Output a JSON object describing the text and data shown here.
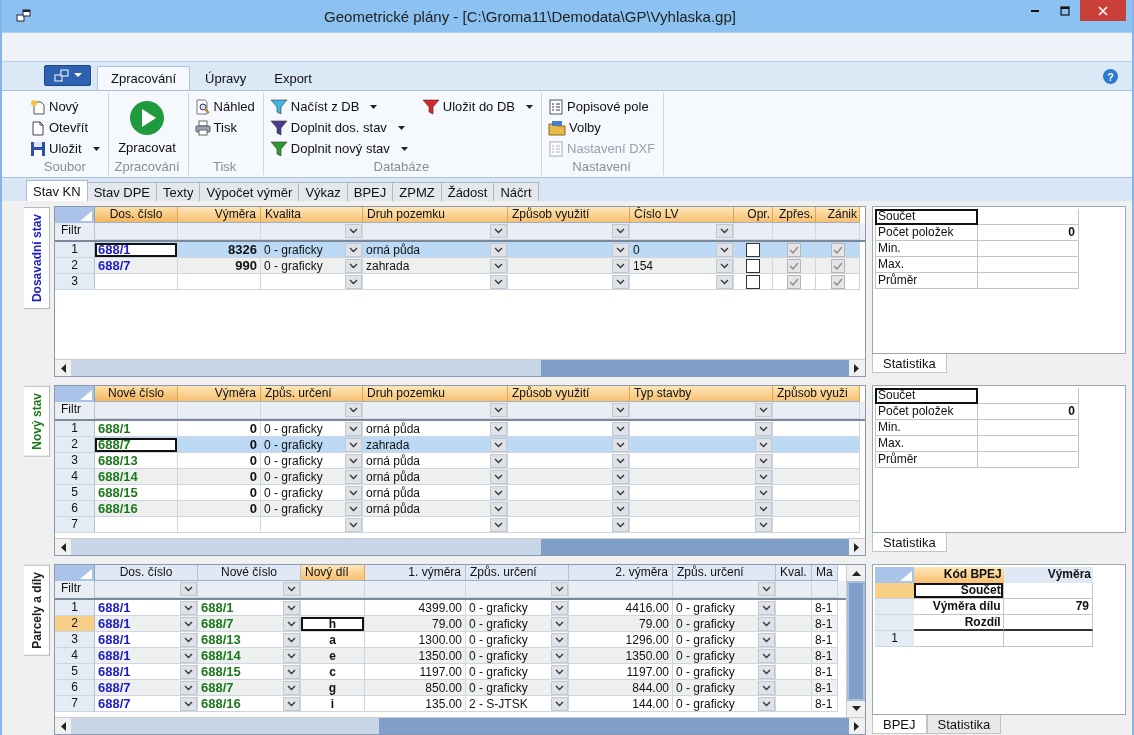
{
  "window": {
    "title": "Geometrické plány - [C:\\Groma11\\Demodata\\GP\\Vyhlaska.gp]"
  },
  "ribbon": {
    "help": "?",
    "tabs": [
      {
        "label": "Zpracování",
        "selected": true
      },
      {
        "label": "Úpravy",
        "selected": false
      },
      {
        "label": "Export",
        "selected": false
      }
    ],
    "groups": [
      {
        "label": "Soubor",
        "items": [
          {
            "label": "Nový",
            "kind": "small",
            "dropdown": false,
            "disabled": false
          },
          {
            "label": "Otevřít",
            "kind": "small",
            "dropdown": false,
            "disabled": false
          },
          {
            "label": "Uložit",
            "kind": "small",
            "dropdown": true,
            "disabled": false
          }
        ]
      },
      {
        "label": "Zpracování",
        "items": [
          {
            "label": "Zpracovat",
            "kind": "large",
            "dropdown": false,
            "disabled": false
          }
        ]
      },
      {
        "label": "Tisk",
        "items": [
          {
            "label": "Náhled",
            "kind": "small",
            "dropdown": false,
            "disabled": false
          },
          {
            "label": "Tisk",
            "kind": "small",
            "dropdown": false,
            "disabled": false
          }
        ]
      },
      {
        "label": "Databáze",
        "items": [
          {
            "label": "Načíst z DB",
            "kind": "small",
            "dropdown": true,
            "disabled": false,
            "color": "#3fb6e8"
          },
          {
            "label": "Doplnit dos. stav",
            "kind": "small",
            "dropdown": true,
            "disabled": false,
            "color": "#4a3d8f"
          },
          {
            "label": "Doplnit nový stav",
            "kind": "small",
            "dropdown": true,
            "disabled": false,
            "color": "#2e9a2e"
          },
          {
            "label": "Uložit do DB",
            "kind": "small",
            "dropdown": true,
            "disabled": false,
            "color": "#d8262b"
          }
        ]
      },
      {
        "label": "Nastavení",
        "items": [
          {
            "label": "Popisové pole",
            "kind": "small",
            "dropdown": false,
            "disabled": false
          },
          {
            "label": "Volby",
            "kind": "small",
            "dropdown": false,
            "disabled": false
          },
          {
            "label": "Nastavení DXF",
            "kind": "small",
            "dropdown": false,
            "disabled": true
          }
        ]
      }
    ]
  },
  "doc_tabs": [
    {
      "label": "Stav KN",
      "selected": true
    },
    {
      "label": "Stav DPE",
      "selected": false
    },
    {
      "label": "Texty",
      "selected": false
    },
    {
      "label": "Výpočet výměr",
      "selected": false
    },
    {
      "label": "Výkaz",
      "selected": false
    },
    {
      "label": "BPEJ",
      "selected": false
    },
    {
      "label": "ZPMZ",
      "selected": false
    },
    {
      "label": "Žádost",
      "selected": false
    },
    {
      "label": "Náčrt",
      "selected": false
    }
  ],
  "panels": [
    {
      "side_tab": {
        "label": "Dosavadní stav",
        "color": "#1c1cc8"
      },
      "grid": {
        "filter_label": "Filtr",
        "columns": [
          {
            "label": "Dos. číslo",
            "kind": "parcel_old",
            "dropdown": false,
            "current": true
          },
          {
            "label": "Výměra",
            "kind": "area",
            "dropdown": false,
            "current": false
          },
          {
            "label": "Kvalita",
            "kind": "text",
            "dropdown": true,
            "current": false
          },
          {
            "label": "Druh pozemku",
            "kind": "text",
            "dropdown": true,
            "current": false
          },
          {
            "label": "Způsob využití",
            "kind": "text",
            "dropdown": true,
            "current": false
          },
          {
            "label": "Číslo LV",
            "kind": "text",
            "dropdown": true,
            "current": false
          },
          {
            "label": "Opr.",
            "kind": "check",
            "dropdown": false,
            "current": false,
            "disabled": false
          },
          {
            "label": "Zpřes.",
            "kind": "check",
            "dropdown": false,
            "current": false,
            "disabled": true
          },
          {
            "label": "Zánik",
            "kind": "check",
            "dropdown": false,
            "current": false,
            "disabled": true
          }
        ],
        "rows": [
          {
            "number": "1",
            "selected": true,
            "cells": [
              "688/1",
              "8326",
              "0 - graficky",
              "orná půda",
              null,
              "0",
              false,
              true,
              true
            ]
          },
          {
            "number": "2",
            "selected": false,
            "cells": [
              "688/7",
              "990",
              "0 - graficky",
              "zahrada",
              null,
              "154",
              false,
              true,
              true
            ]
          },
          {
            "number": "3",
            "selected": false,
            "cells": [
              null,
              null,
              null,
              null,
              null,
              null,
              false,
              true,
              true
            ]
          }
        ]
      },
      "right": {
        "kind": "stats",
        "rows": [
          {
            "label": "Součet",
            "focused": true
          },
          {
            "label": "Počet položek",
            "value": "0",
            "focused": false
          },
          {
            "label": "Min.",
            "focused": false
          },
          {
            "label": "Max.",
            "focused": false
          },
          {
            "label": "Průměr",
            "focused": false
          }
        ],
        "tabs": [
          {
            "label": "Statistika",
            "selected": true
          }
        ]
      }
    },
    {
      "side_tab": {
        "label": "Nový stav",
        "color": "#1a7a1a"
      },
      "grid": {
        "filter_label": "Filtr",
        "columns": [
          {
            "label": "Nové číslo",
            "kind": "parcel_new",
            "dropdown": false,
            "current": true
          },
          {
            "label": "Výměra",
            "kind": "area",
            "dropdown": false,
            "current": false
          },
          {
            "label": "Způs. určení",
            "kind": "text",
            "dropdown": true,
            "current": false
          },
          {
            "label": "Druh pozemku",
            "kind": "text",
            "dropdown": true,
            "current": false
          },
          {
            "label": "Způsob využití",
            "kind": "text",
            "dropdown": true,
            "current": false
          },
          {
            "label": "Typ stavby",
            "kind": "text",
            "dropdown": true,
            "current": false
          },
          {
            "label": "Způsob využi",
            "kind": "text",
            "dropdown": false,
            "current": false
          }
        ],
        "rows": [
          {
            "number": "1",
            "selected": false,
            "cells": [
              "688/1",
              "0",
              "0 - graficky",
              "orná půda",
              null,
              null,
              null
            ]
          },
          {
            "number": "2",
            "selected": true,
            "cells": [
              "688/7",
              "0",
              "0 - graficky",
              "zahrada",
              null,
              null,
              null
            ]
          },
          {
            "number": "3",
            "selected": false,
            "cells": [
              "688/13",
              "0",
              "0 - graficky",
              "orná půda",
              null,
              null,
              null
            ]
          },
          {
            "number": "4",
            "selected": false,
            "cells": [
              "688/14",
              "0",
              "0 - graficky",
              "orná půda",
              null,
              null,
              null
            ]
          },
          {
            "number": "5",
            "selected": false,
            "cells": [
              "688/15",
              "0",
              "0 - graficky",
              "orná půda",
              null,
              null,
              null
            ]
          },
          {
            "number": "6",
            "selected": false,
            "cells": [
              "688/16",
              "0",
              "0 - graficky",
              "orná půda",
              null,
              null,
              null
            ]
          },
          {
            "number": "7",
            "selected": false,
            "cells": [
              null,
              null,
              null,
              null,
              null,
              null,
              null
            ]
          }
        ]
      },
      "right": {
        "kind": "stats",
        "rows": [
          {
            "label": "Součet",
            "focused": true
          },
          {
            "label": "Počet položek",
            "value": "0",
            "focused": false
          },
          {
            "label": "Min.",
            "focused": false
          },
          {
            "label": "Max.",
            "focused": false
          },
          {
            "label": "Průměr",
            "focused": false
          }
        ],
        "tabs": [
          {
            "label": "Statistika",
            "selected": true
          }
        ]
      }
    },
    {
      "side_tab": {
        "label": "Parcely a díly",
        "color": "#202020"
      },
      "grid": {
        "filter_label": "Filtr",
        "columns": [
          {
            "label": "Dos. číslo",
            "kind": "parcel_old",
            "dropdown": true,
            "current": false
          },
          {
            "label": "Nové číslo",
            "kind": "parcel_new",
            "dropdown": true,
            "current": false
          },
          {
            "label": "Nový díl",
            "kind": "part",
            "dropdown": false,
            "current": true
          },
          {
            "label": "1. výměra",
            "kind": "number",
            "dropdown": false,
            "current": false
          },
          {
            "label": "Způs. určení",
            "kind": "text",
            "dropdown": true,
            "current": false
          },
          {
            "label": "2. výměra",
            "kind": "number",
            "dropdown": false,
            "current": false
          },
          {
            "label": "Způs. určení",
            "kind": "text",
            "dropdown": true,
            "current": false
          },
          {
            "label": "Kval.",
            "kind": "text",
            "dropdown": false,
            "current": false
          },
          {
            "label": "Ma",
            "kind": "text",
            "dropdown": false,
            "current": false
          }
        ],
        "rows": [
          {
            "number": "1",
            "selected": false,
            "cells": [
              "688/1",
              "688/1",
              null,
              "4399.00",
              "0 - graficky",
              "4416.00",
              "0 - graficky",
              null,
              "8-1"
            ]
          },
          {
            "number": "2",
            "selected": true,
            "cells": [
              "688/1",
              "688/7",
              "h",
              "79.00",
              "0 - graficky",
              "79.00",
              "0 - graficky",
              null,
              "8-1"
            ]
          },
          {
            "number": "3",
            "selected": false,
            "cells": [
              "688/1",
              "688/13",
              "a",
              "1300.00",
              "0 - graficky",
              "1296.00",
              "0 - graficky",
              null,
              "8-1"
            ]
          },
          {
            "number": "4",
            "selected": false,
            "cells": [
              "688/1",
              "688/14",
              "e",
              "1350.00",
              "0 - graficky",
              "1350.00",
              "0 - graficky",
              null,
              "8-1"
            ]
          },
          {
            "number": "5",
            "selected": false,
            "cells": [
              "688/1",
              "688/15",
              "c",
              "1197.00",
              "0 - graficky",
              "1197.00",
              "0 - graficky",
              null,
              "8-1"
            ]
          },
          {
            "number": "6",
            "selected": false,
            "cells": [
              "688/7",
              "688/7",
              "g",
              "850.00",
              "0 - graficky",
              "844.00",
              "0 - graficky",
              null,
              "8-1"
            ]
          },
          {
            "number": "7",
            "selected": false,
            "cells": [
              "688/7",
              "688/16",
              "i",
              "135.00",
              "2 - S-JTSK",
              "144.00",
              "0 - graficky",
              null,
              "8-1"
            ]
          }
        ]
      },
      "right": {
        "kind": "bpej",
        "columns": [
          {
            "label": "Kód BPEJ",
            "current": true
          },
          {
            "label": "Výměra",
            "current": false
          }
        ],
        "summary_rows": [
          {
            "label": "Součet",
            "focused": true
          },
          {
            "label": "Výměra dílu",
            "value": "79",
            "focused": false
          },
          {
            "label": "Rozdíl",
            "focused": false
          }
        ],
        "rows": [
          {
            "number": "1"
          }
        ],
        "tabs": [
          {
            "label": "BPEJ",
            "selected": true
          },
          {
            "label": "Statistika",
            "selected": false
          }
        ]
      }
    }
  ]
}
